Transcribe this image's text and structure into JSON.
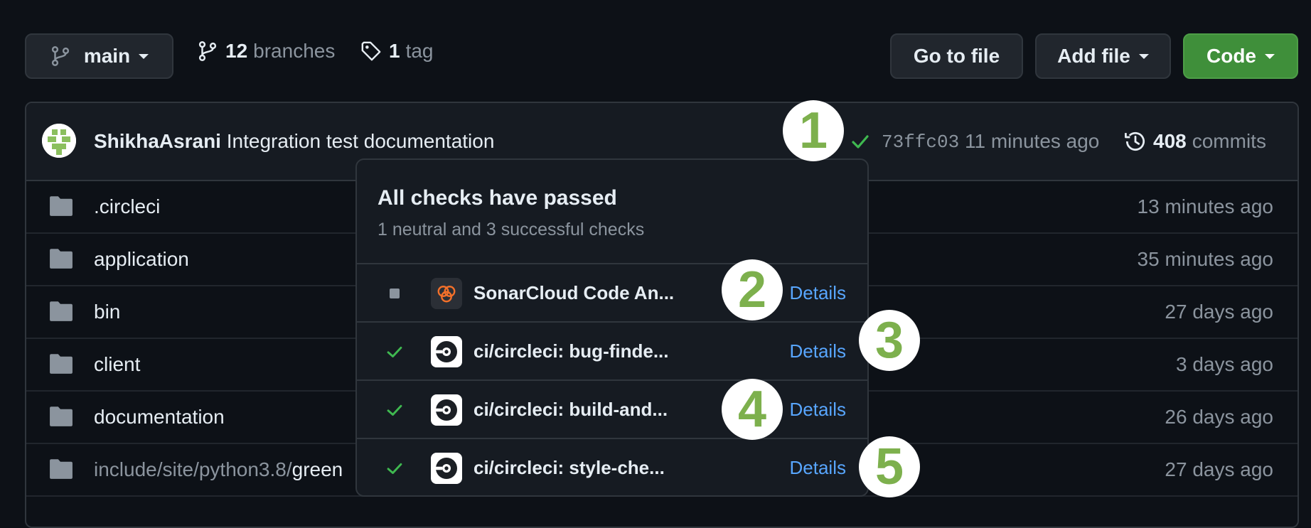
{
  "toolbar": {
    "branch_name": "main",
    "branches_count": "12",
    "branches_label": "branches",
    "tags_count": "1",
    "tags_label": "tag",
    "go_to_file": "Go to file",
    "add_file": "Add file",
    "code": "Code"
  },
  "commit": {
    "author": "ShikhaAsrani",
    "message": "Integration test documentation",
    "hash": "73ffc03",
    "time": "11 minutes ago",
    "commits_count": "408",
    "commits_label": "commits"
  },
  "files": [
    {
      "name": ".circleci",
      "time": "13 minutes ago"
    },
    {
      "name": "application",
      "time": "35 minutes ago"
    },
    {
      "name": "bin",
      "time": "27 days ago"
    },
    {
      "name": "client",
      "time": "3 days ago"
    },
    {
      "name": "documentation",
      "time": "26 days ago"
    },
    {
      "name_muted": "include/site/python3.8/",
      "name_strong": "green",
      "time": "27 days ago"
    }
  ],
  "checks_popup": {
    "title": "All checks have passed",
    "subtitle": "1 neutral and 3 successful checks",
    "checks": [
      {
        "name": "SonarCloud Code An...",
        "details": "Details",
        "status": "neutral"
      },
      {
        "name": "ci/circleci: bug-finde...",
        "details": "Details",
        "status": "success"
      },
      {
        "name": "ci/circleci: build-and...",
        "details": "Details",
        "status": "success"
      },
      {
        "name": "ci/circleci: style-che...",
        "details": "Details",
        "status": "success"
      }
    ]
  },
  "callouts": [
    "1",
    "2",
    "3",
    "4",
    "5"
  ],
  "colors": {
    "background": "#0d1117",
    "code_button": "#238636",
    "success": "#3fb950",
    "link": "#58a6ff",
    "callout": "#7db04d",
    "sonar": "#f3702a"
  }
}
